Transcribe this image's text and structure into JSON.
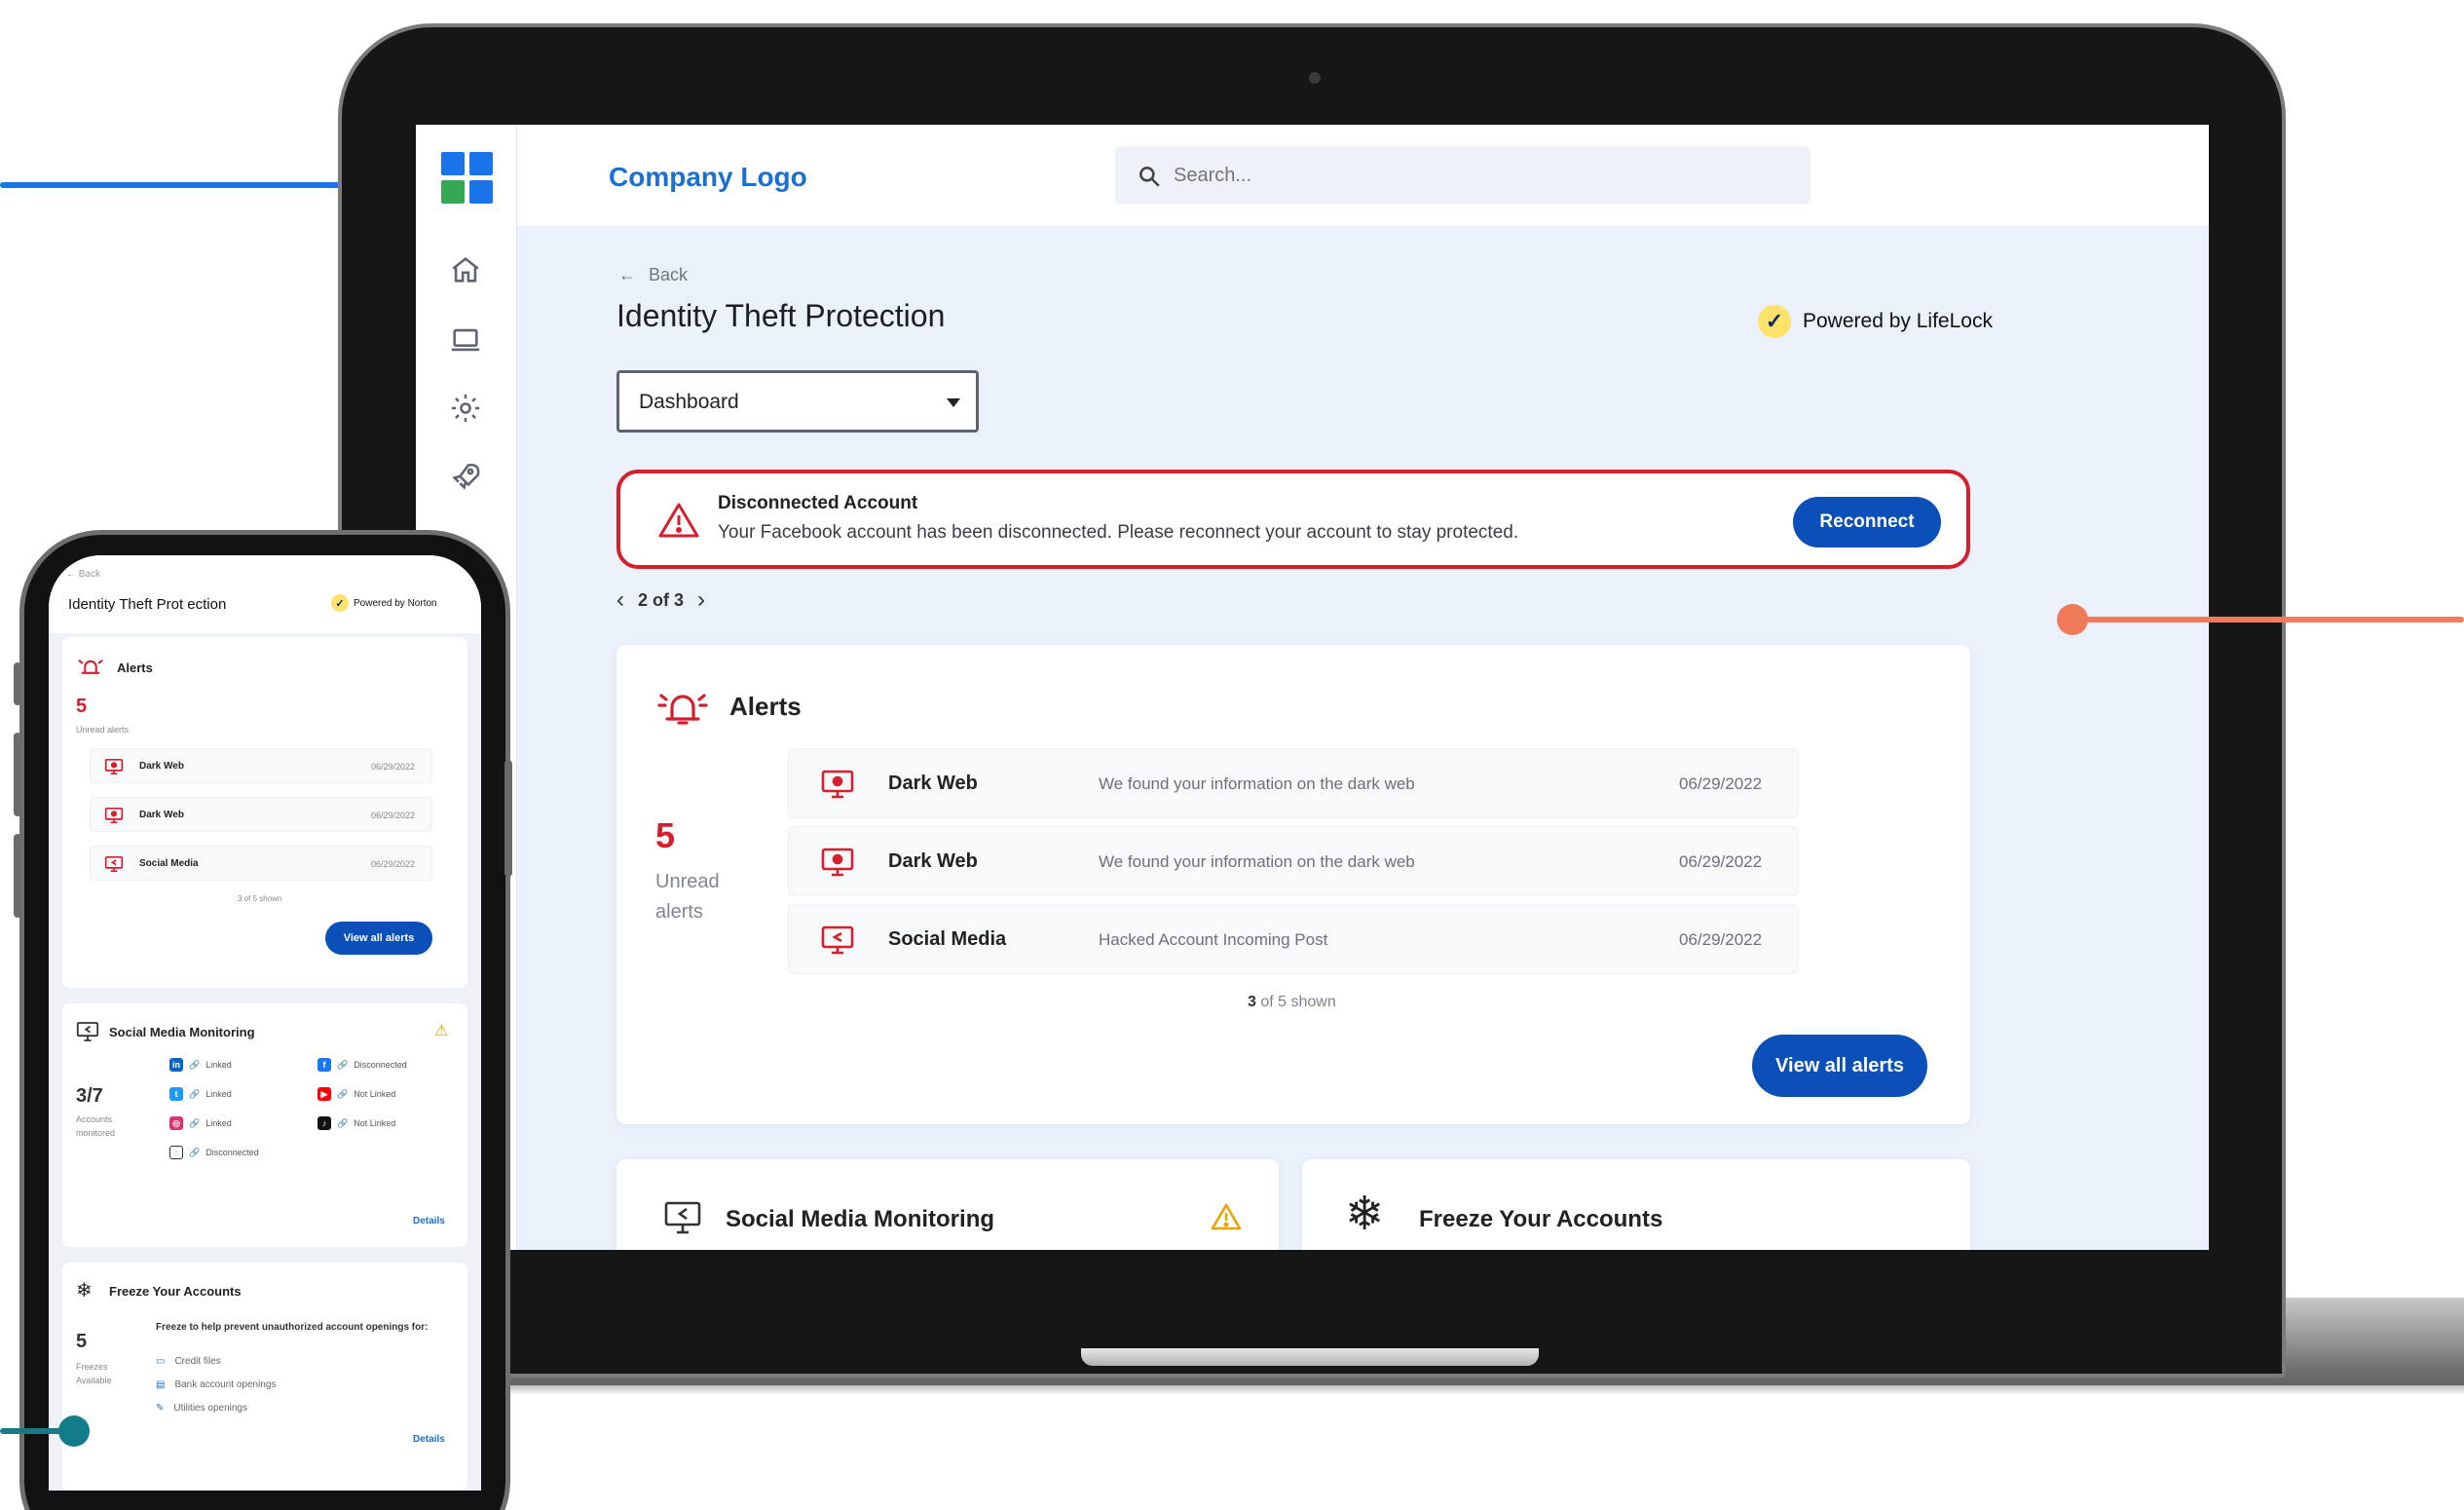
{
  "topbar": {
    "company_logo": "Company Logo",
    "search_placeholder": "Search..."
  },
  "page": {
    "back_label": "Back",
    "title": "Identity Theft Protection",
    "powered_by": "Powered by LifeLock",
    "view_select": "Dashboard"
  },
  "banner": {
    "title": "Disconnected Account",
    "message": "Your Facebook account has been disconnected. Please reconnect your account to stay protected.",
    "button": "Reconnect"
  },
  "pager": {
    "label": "2 of 3"
  },
  "alerts": {
    "title": "Alerts",
    "count": "5",
    "count_label": "Unread alerts",
    "rows": [
      {
        "type": "Dark Web",
        "message": "We found your information on the dark web",
        "date": "06/29/2022"
      },
      {
        "type": "Dark Web",
        "message": "We found your information on the dark web",
        "date": "06/29/2022"
      },
      {
        "type": "Social Media",
        "message": "Hacked Account Incoming Post",
        "date": "06/29/2022"
      }
    ],
    "shown_count": "3",
    "shown_suffix": "of 5 shown",
    "view_all": "View all alerts"
  },
  "social_card": {
    "title": "Social Media Monitoring"
  },
  "freeze_card": {
    "title": "Freeze Your Accounts"
  },
  "phone": {
    "back_label": "Back",
    "title": "Identity Theft Prot ection",
    "powered_by": "Powered by Norton",
    "alerts": {
      "title": "Alerts",
      "count": "5",
      "count_label": "Unread alerts",
      "rows": [
        {
          "type": "Dark Web",
          "date": "06/29/2022"
        },
        {
          "type": "Dark Web",
          "date": "06/29/2022"
        },
        {
          "type": "Social Media",
          "date": "06/29/2022"
        }
      ],
      "shown": "3 of 5 shown",
      "view_all": "View all alerts"
    },
    "social": {
      "title": "Social Media Monitoring",
      "count": "3/7",
      "count_label": "Accounts monitored",
      "linked": "Linked",
      "disconnected": "Disconnected",
      "not_linked": "Not Linked",
      "details": "Details"
    },
    "freeze": {
      "title": "Freeze Your Accounts",
      "count": "5",
      "count_label": "Freezes Available",
      "desc": "Freeze to help prevent unauthorized account openings for:",
      "items": [
        "Credit files",
        "Bank account openings",
        "Utilities openings"
      ],
      "details": "Details"
    }
  },
  "colors": {
    "brand_blue": "#0b4fb8",
    "logo_blue": "#1a6fd6",
    "alert_red": "#d61f2c",
    "badge_yellow": "#ffe26a",
    "callout_blue": "#1a73e8",
    "callout_orange": "#ef7b5a",
    "callout_teal": "#127c8a"
  }
}
